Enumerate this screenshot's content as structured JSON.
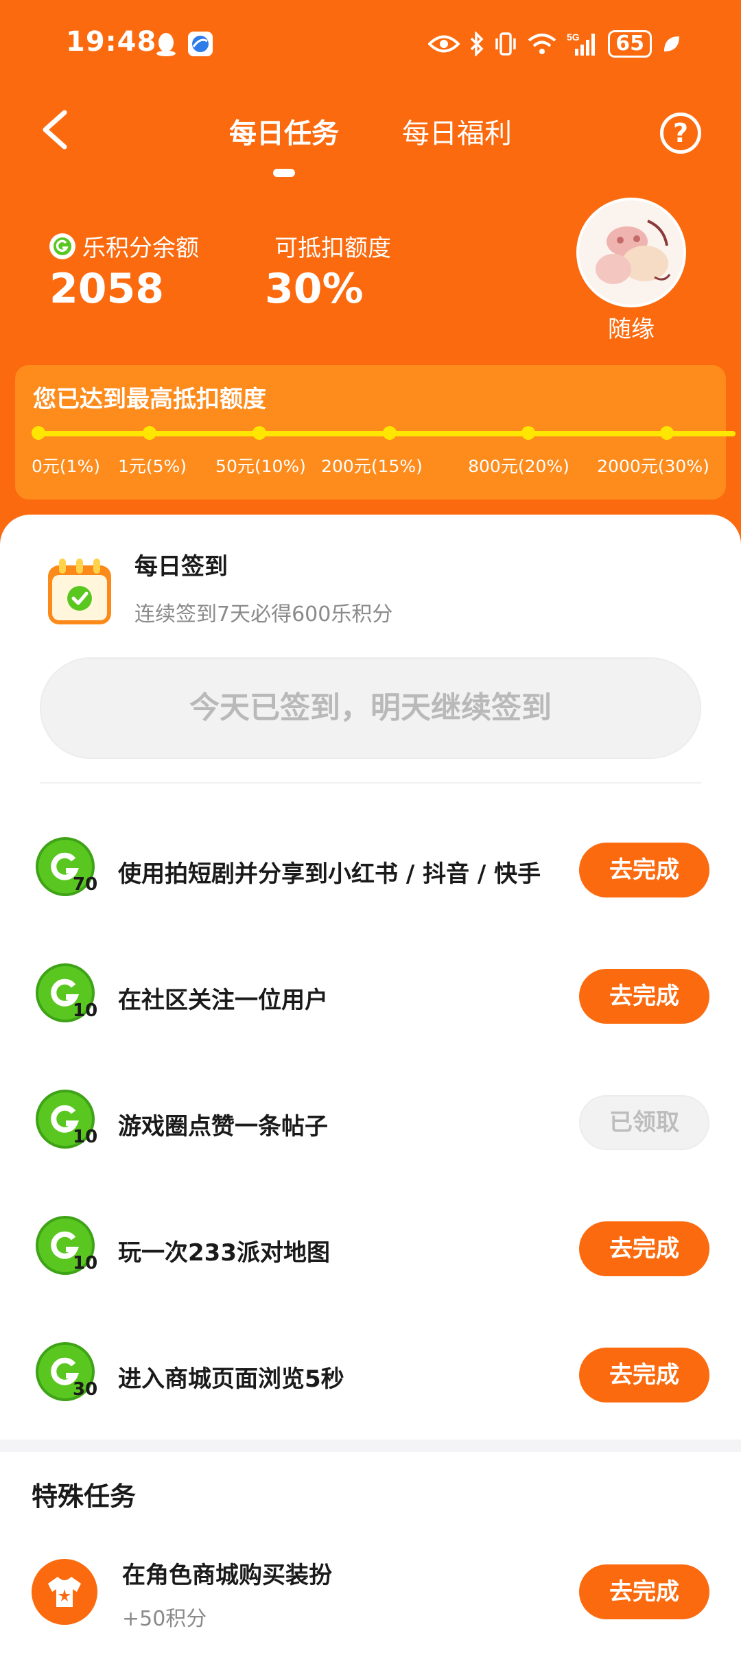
{
  "colors": {
    "brand": "#fb6a0e",
    "progress": "#ffe600",
    "progress_card": "#fe8c1d",
    "points_green": "#5ac721"
  },
  "status_bar": {
    "time": "19:48",
    "battery": "65",
    "network": "5G"
  },
  "header": {
    "tabs": [
      {
        "label": "每日任务",
        "active": true
      },
      {
        "label": "每日福利",
        "active": false
      }
    ]
  },
  "points": {
    "balance_label": "乐积分余额",
    "balance": "2058",
    "deduct_label": "可抵扣额度",
    "deduct_value": "30%"
  },
  "user": {
    "name": "随缘"
  },
  "progress": {
    "title": "您已达到最高抵扣额度",
    "current_level": 6,
    "levels": [
      "0元(1%)",
      "1元(5%)",
      "50元(10%)",
      "200元(15%)",
      "800元(20%)",
      "2000元(30%)"
    ]
  },
  "checkin": {
    "title": "每日签到",
    "subtitle": "连续签到7天必得600乐积分",
    "button": "今天已签到，明天继续签到"
  },
  "tasks": [
    {
      "points": "70",
      "label": "使用拍短剧并分享到小红书 / 抖音 / 快手",
      "button": "去完成"
    },
    {
      "points": "10",
      "label": "在社区关注一位用户",
      "button": "去完成"
    },
    {
      "points": "10",
      "label": "游戏圈点赞一条帖子",
      "button": "已领取"
    },
    {
      "points": "10",
      "label": "玩一次233派对地图",
      "button": "去完成"
    },
    {
      "points": "30",
      "label": "进入商城页面浏览5秒",
      "button": "去完成"
    }
  ],
  "special": {
    "title": "特殊任务",
    "items": [
      {
        "label": "在角色商城购买装扮",
        "sub": "+50积分",
        "button": "去完成"
      }
    ]
  }
}
